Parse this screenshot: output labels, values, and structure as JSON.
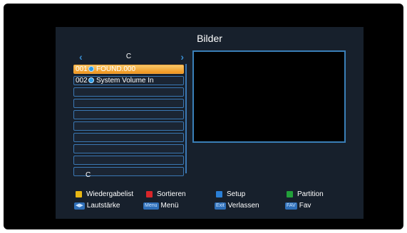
{
  "screen": {
    "title": "Bilder"
  },
  "navigator": {
    "left_arrow": "‹",
    "right_arrow": "›",
    "drive": "C"
  },
  "files": [
    {
      "number": "001",
      "name": "FOUND.000",
      "selected": true
    },
    {
      "number": "002",
      "name": "System Volume In",
      "selected": false
    },
    {
      "number": "",
      "name": ""
    },
    {
      "number": "",
      "name": ""
    },
    {
      "number": "",
      "name": ""
    },
    {
      "number": "",
      "name": ""
    },
    {
      "number": "",
      "name": ""
    },
    {
      "number": "",
      "name": ""
    },
    {
      "number": "",
      "name": ""
    },
    {
      "number": "",
      "name": ""
    }
  ],
  "current_path": "C",
  "legend": {
    "playlist": {
      "label": "Wiedergabelist",
      "color": "#e8b714"
    },
    "sort": {
      "label": "Sortieren",
      "color": "#d8262a"
    },
    "setup": {
      "label": "Setup",
      "color": "#2a7fd6"
    },
    "partition": {
      "label": "Partition",
      "color": "#22a03a"
    },
    "volume": {
      "button": "◀▶",
      "label": "Lautstärke"
    },
    "menu": {
      "button": "Menu",
      "label": "Menü"
    },
    "exit": {
      "button": "Exit",
      "label": "Verlassen"
    },
    "fav": {
      "button": "FAV",
      "label": "Fav"
    }
  },
  "colors": {
    "panel": "#17202c",
    "accent": "#3a8fd4",
    "selection": "#f0951e"
  }
}
